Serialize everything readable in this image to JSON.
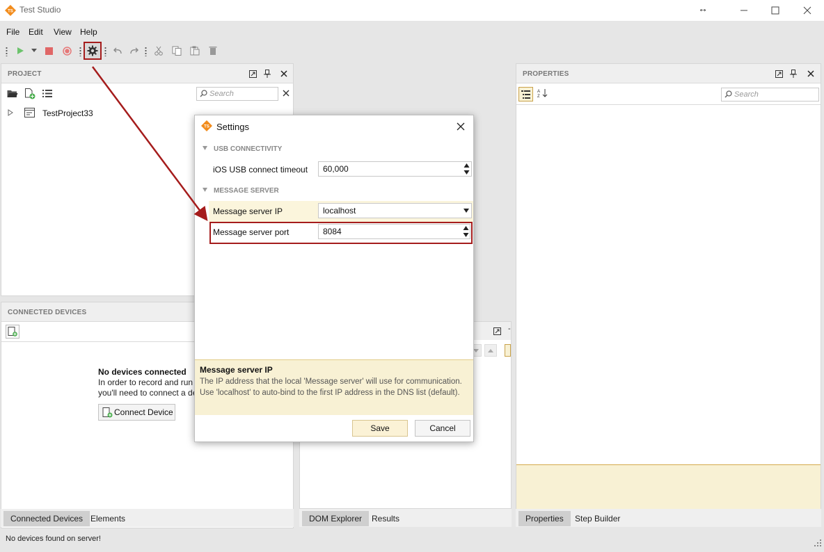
{
  "app": {
    "title": "Test Studio",
    "window_buttons": [
      "minimize-icon",
      "maximize-icon",
      "close-icon"
    ]
  },
  "menu": {
    "items": [
      "File",
      "Edit",
      "View",
      "Help"
    ]
  },
  "toolbar": {
    "icons": [
      "run-icon",
      "run-dropdown-icon",
      "stop-icon",
      "record-icon",
      "settings-icon",
      "undo-icon",
      "redo-icon",
      "cut-icon",
      "copy-icon",
      "paste-icon",
      "delete-icon"
    ]
  },
  "project_panel": {
    "title": "PROJECT",
    "search_placeholder": "Search",
    "tree": [
      {
        "label": "TestProject33"
      }
    ]
  },
  "devices_panel": {
    "title": "CONNECTED DEVICES",
    "empty_title": "No devices connected",
    "empty_line1": "In order to record and run te",
    "empty_line2": "you'll need to connect a dev",
    "connect_button": "Connect Device"
  },
  "left_tabs": [
    "Connected Devices",
    "Elements"
  ],
  "middle_tabs": [
    "DOM Explorer",
    "Results"
  ],
  "properties_panel": {
    "title": "PROPERTIES",
    "search_placeholder": "Search"
  },
  "right_tabs": [
    "Properties",
    "Step Builder"
  ],
  "status_bar": {
    "text": "No devices found on server!"
  },
  "dialog": {
    "title": "Settings",
    "sections": [
      {
        "label": "USB CONNECTIVITY"
      },
      {
        "label": "MESSAGE SERVER"
      }
    ],
    "fields": {
      "ios_timeout_label": "iOS USB connect timeout",
      "ios_timeout_value": "60,000",
      "server_ip_label": "Message server IP",
      "server_ip_value": "localhost",
      "server_port_label": "Message server port",
      "server_port_value": "8084"
    },
    "help": {
      "title": "Message server IP",
      "text": "The IP address that the local 'Message server' will use for communication. Use 'localhost' to auto-bind to the first IP address in the DNS list (default)."
    },
    "save_label": "Save",
    "cancel_label": "Cancel"
  },
  "colors": {
    "annotation": "#a51c1c",
    "help_background": "#f8f1d4",
    "highlight_row": "#fbf5dc",
    "brand": "#f28c1c"
  }
}
